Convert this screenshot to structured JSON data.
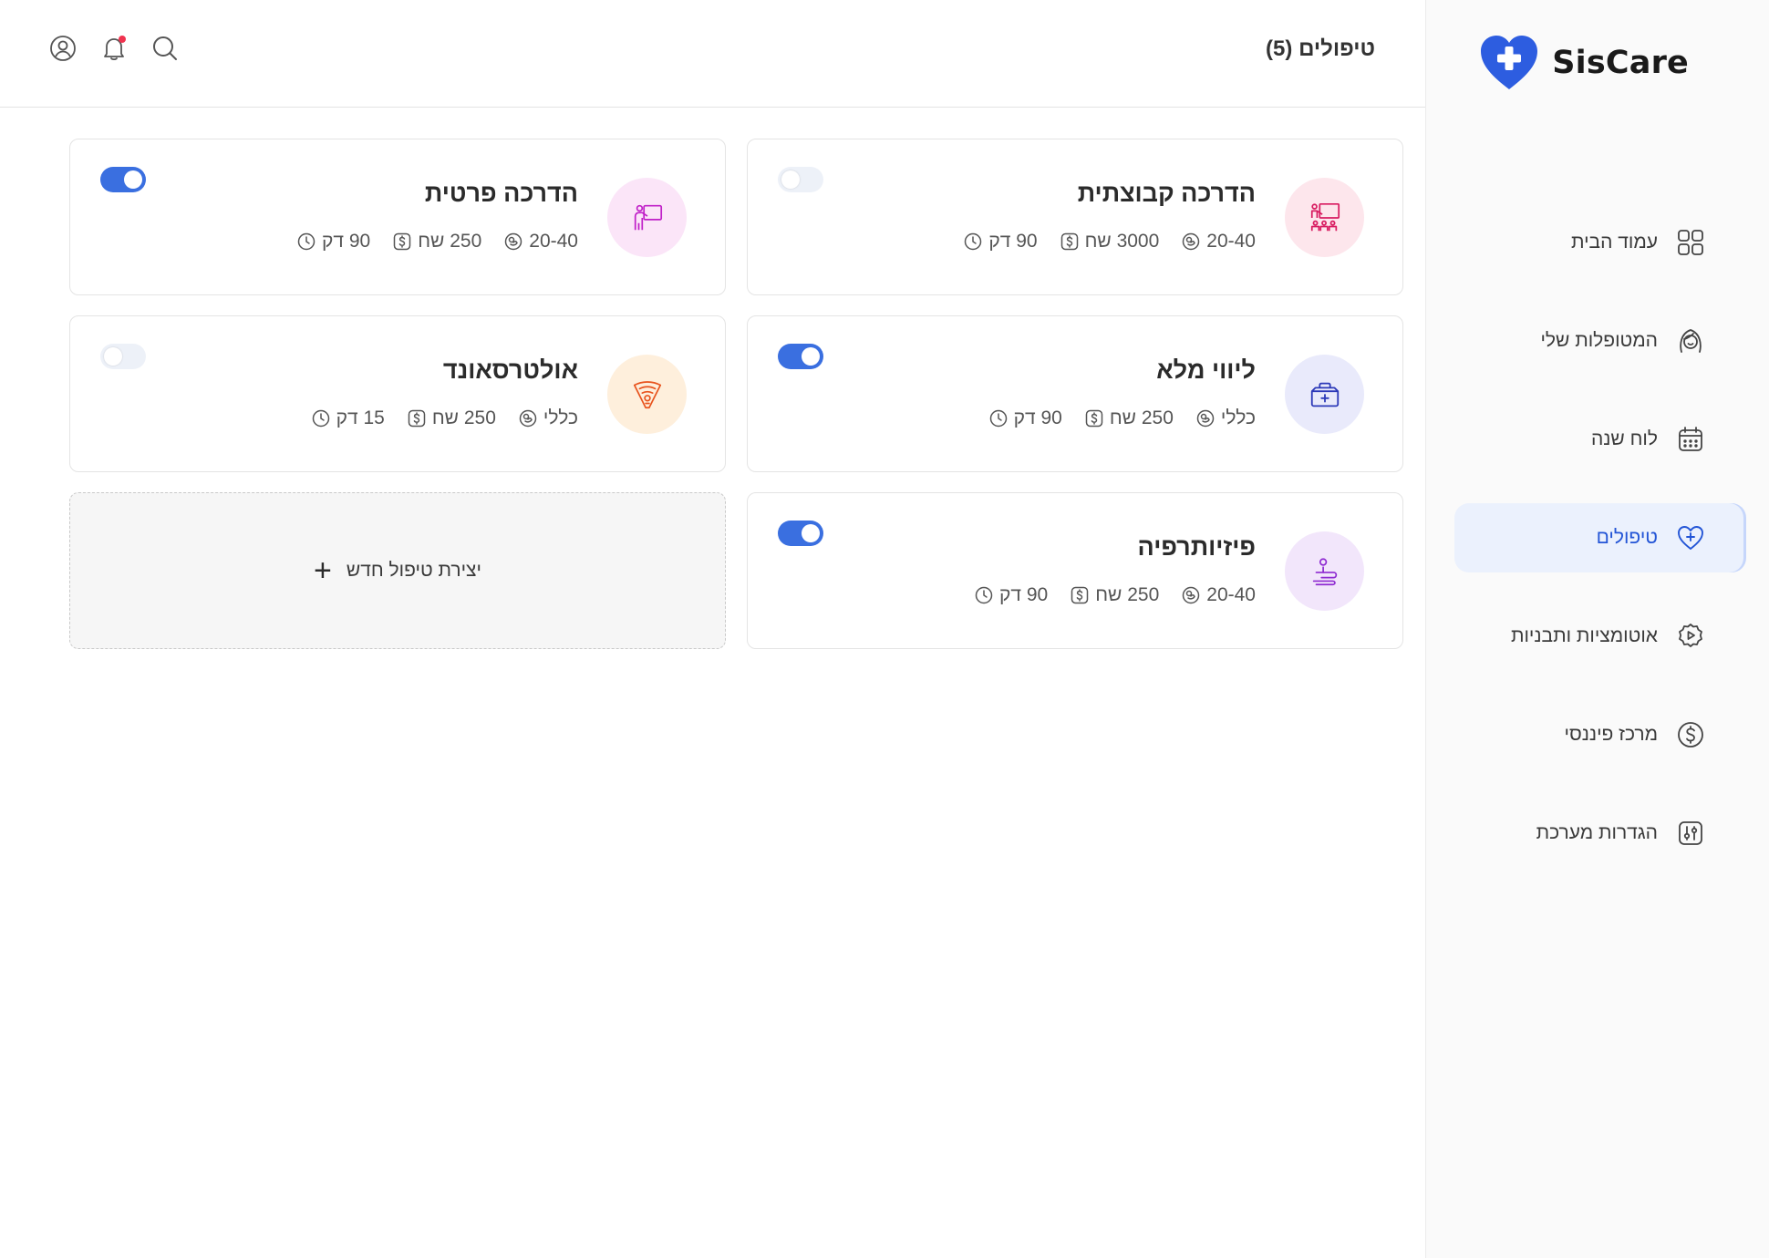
{
  "app": {
    "name": "SisCare"
  },
  "header": {
    "title": "טיפולים (5)"
  },
  "nav": [
    {
      "label": "עמוד הבית",
      "icon": "home-grid-icon"
    },
    {
      "label": "המטופלות שלי",
      "icon": "patient-face-icon"
    },
    {
      "label": "לוח שנה",
      "icon": "calendar-icon"
    },
    {
      "label": "טיפולים",
      "icon": "heart-plus-icon",
      "active": true
    },
    {
      "label": "אוטומציות ותבניות",
      "icon": "automation-icon"
    },
    {
      "label": "מרכז פיננסי",
      "icon": "dollar-circle-icon"
    },
    {
      "label": "הגדרות מערכת",
      "icon": "settings-sliders-icon"
    }
  ],
  "treatments": [
    {
      "title": "הדרכה קבוצתית",
      "duration": "90 דק",
      "price": "3000 שח",
      "week": "20-40",
      "enabled": false,
      "icon": "group-training-icon",
      "color": "#d81b60",
      "bg": "#fde6ec"
    },
    {
      "title": "הדרכה פרטית",
      "duration": "90 דק",
      "price": "250 שח",
      "week": "20-40",
      "enabled": true,
      "icon": "private-training-icon",
      "color": "#c020c8",
      "bg": "#fbe5f8"
    },
    {
      "title": "ליווי מלא",
      "duration": "90 דק",
      "price": "250 שח",
      "week": "כללי",
      "enabled": true,
      "icon": "medical-kit-icon",
      "color": "#2c39b8",
      "bg": "#e9eafb"
    },
    {
      "title": "אולטרסאונד",
      "duration": "15 דק",
      "price": "250 שח",
      "week": "כללי",
      "enabled": false,
      "icon": "ultrasound-icon",
      "color": "#e8531d",
      "bg": "#feefdc"
    },
    {
      "title": "פיזיותרפיה",
      "duration": "90 דק",
      "price": "250 שח",
      "week": "20-40",
      "enabled": true,
      "icon": "physiotherapy-icon",
      "color": "#8e2ad1",
      "bg": "#f2e6fb"
    }
  ],
  "create": {
    "label": "יצירת טיפול חדש"
  },
  "colors": {
    "accent": "#3a6fe0",
    "logo": "#2d5de0",
    "notification": "#f0334f"
  }
}
